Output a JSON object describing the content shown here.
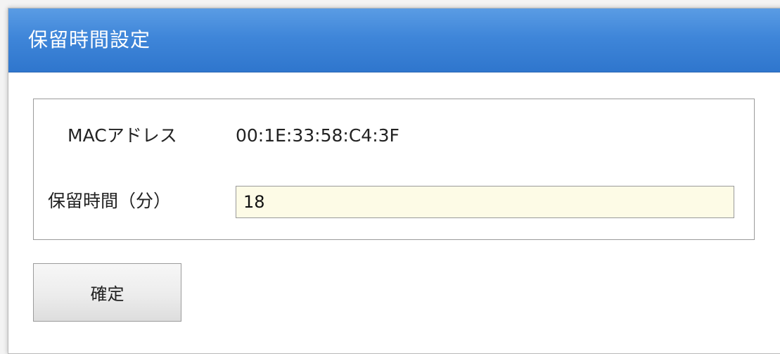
{
  "dialog": {
    "title": "保留時間設定"
  },
  "form": {
    "mac": {
      "label": "MACアドレス",
      "value": "00:1E:33:58:C4:3F"
    },
    "hold_time": {
      "label": "保留時間（分）",
      "value": "18"
    }
  },
  "actions": {
    "confirm_label": "確定"
  },
  "colors": {
    "titlebar": "#3f86d9",
    "input_background": "#fdfbe6",
    "button_background": "#ececec"
  }
}
